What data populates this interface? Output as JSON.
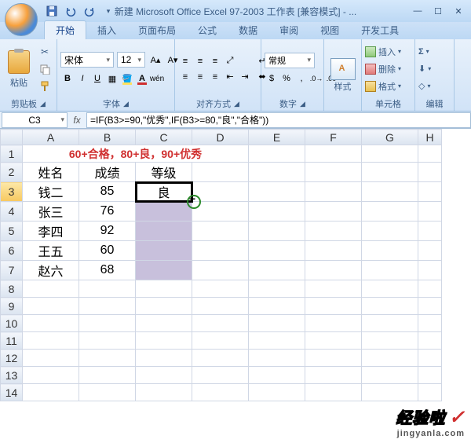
{
  "title": "新建 Microsoft Office Excel 97-2003 工作表  [兼容模式] - ...",
  "tabs": [
    "开始",
    "插入",
    "页面布局",
    "公式",
    "数据",
    "审阅",
    "视图",
    "开发工具"
  ],
  "active_tab": 0,
  "ribbon": {
    "clipboard": {
      "paste": "粘贴",
      "label": "剪贴板"
    },
    "font": {
      "name": "宋体",
      "size": "12",
      "label": "字体"
    },
    "alignment": {
      "label": "对齐方式"
    },
    "number": {
      "format": "常规",
      "label": "数字"
    },
    "styles": {
      "btn": "样式",
      "label": ""
    },
    "cells": {
      "insert": "插入",
      "delete": "删除",
      "format": "格式",
      "label": "单元格"
    },
    "editing": {
      "label": "编辑"
    }
  },
  "name_box": "C3",
  "formula": "=IF(B3>=90,\"优秀\",IF(B3>=80,\"良\",\"合格\"))",
  "columns": [
    "A",
    "B",
    "C",
    "D",
    "E",
    "F",
    "G",
    "H"
  ],
  "rows": [
    "1",
    "2",
    "3",
    "4",
    "5",
    "6",
    "7",
    "8",
    "9",
    "10",
    "11",
    "12",
    "13",
    "14"
  ],
  "grid": {
    "r1": {
      "merged_text": "60+合格，80+良，90+优秀"
    },
    "r2": {
      "A": "姓名",
      "B": "成绩",
      "C": "等级"
    },
    "r3": {
      "A": "钱二",
      "B": "85",
      "C": "良"
    },
    "r4": {
      "A": "张三",
      "B": "76"
    },
    "r5": {
      "A": "李四",
      "B": "92"
    },
    "r6": {
      "A": "王五",
      "B": "60"
    },
    "r7": {
      "A": "赵六",
      "B": "68"
    }
  },
  "selection": {
    "active": "C3",
    "range": "C3:C7"
  },
  "watermark": {
    "line1": "经验啦",
    "check": "✓",
    "line2": "jingyanla.com"
  }
}
